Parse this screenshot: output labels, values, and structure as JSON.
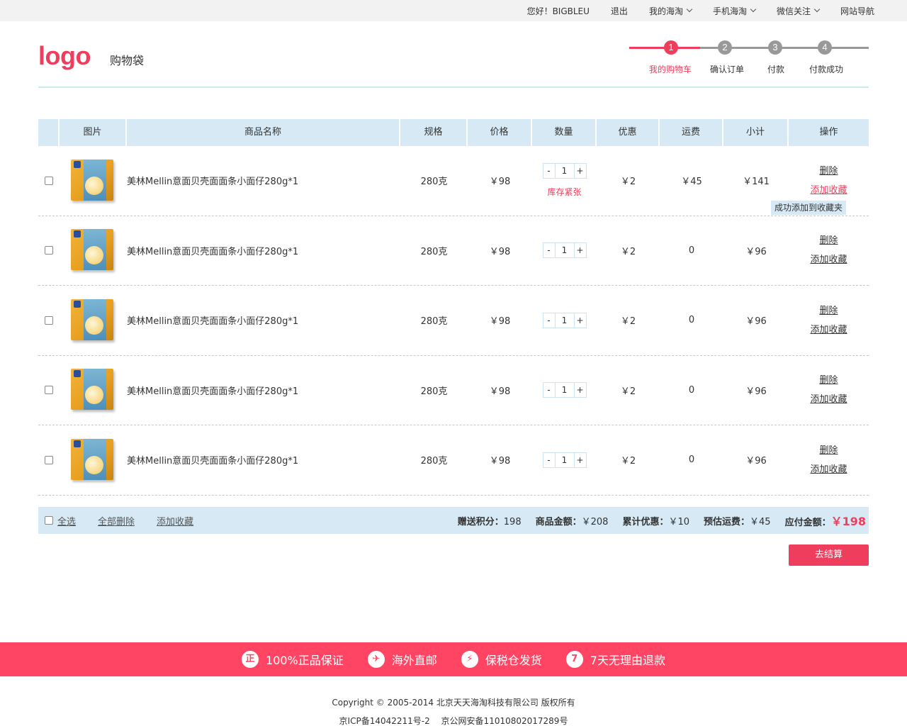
{
  "topnav": {
    "greeting": "您好！BIGBLEU",
    "logout": "退出",
    "my_haitao": "我的海淘",
    "mobile": "手机海淘",
    "wechat": "微信关注",
    "site_nav": "网站导航"
  },
  "header": {
    "logo": "logo",
    "subtitle": "购物袋"
  },
  "steps": [
    {
      "num": "1",
      "label": "我的购物车",
      "active": true
    },
    {
      "num": "2",
      "label": "确认订单",
      "active": false
    },
    {
      "num": "3",
      "label": "付款",
      "active": false
    },
    {
      "num": "4",
      "label": "付款成功",
      "active": false
    }
  ],
  "colors": {
    "accent": "#ef3d5d",
    "table_header": "#d6e9f5",
    "banner": "#ff4563",
    "inactive_step": "#999999"
  },
  "table": {
    "headers": {
      "image": "图片",
      "name": "商品名称",
      "spec": "规格",
      "price": "价格",
      "qty": "数量",
      "discount": "优惠",
      "shipping": "运费",
      "subtotal": "小计",
      "action": "操作"
    },
    "rows": [
      {
        "name": "美林Mellin意面贝壳面面条小面仔280g*1",
        "spec": "280克",
        "price": "￥98",
        "qty": "1",
        "discount": "￥2",
        "shipping": "￥45",
        "subtotal": "￥141",
        "stock_note": "库存紧张",
        "delete": "删除",
        "favorite": "添加收藏",
        "tip": "成功添加到收藏夹"
      },
      {
        "name": "美林Mellin意面贝壳面面条小面仔280g*1",
        "spec": "280克",
        "price": "￥98",
        "qty": "1",
        "discount": "￥2",
        "shipping": "0",
        "subtotal": "￥96",
        "delete": "删除",
        "favorite": "添加收藏"
      },
      {
        "name": "美林Mellin意面贝壳面面条小面仔280g*1",
        "spec": "280克",
        "price": "￥98",
        "qty": "1",
        "discount": "￥2",
        "shipping": "0",
        "subtotal": "￥96",
        "delete": "删除",
        "favorite": "添加收藏"
      },
      {
        "name": "美林Mellin意面贝壳面面条小面仔280g*1",
        "spec": "280克",
        "price": "￥98",
        "qty": "1",
        "discount": "￥2",
        "shipping": "0",
        "subtotal": "￥96",
        "delete": "删除",
        "favorite": "添加收藏"
      },
      {
        "name": "美林Mellin意面贝壳面面条小面仔280g*1",
        "spec": "280克",
        "price": "￥98",
        "qty": "1",
        "discount": "￥2",
        "shipping": "0",
        "subtotal": "￥96",
        "delete": "删除",
        "favorite": "添加收藏"
      }
    ],
    "qty_minus": "-",
    "qty_plus": "+"
  },
  "summary": {
    "select_all": "全选",
    "delete_all": "全部删除",
    "add_favorite": "添加收藏",
    "points_label": "赠送积分：",
    "points_value": "198",
    "goods_label": "商品金额：",
    "goods_value": "￥208",
    "discount_label": "累计优惠：",
    "discount_value": "￥10",
    "shipping_label": "预估运费：",
    "shipping_value": "￥45",
    "total_label": "应付金额：",
    "total_value": "￥198"
  },
  "checkout": "去结算",
  "banner": [
    {
      "icon": "正",
      "text": "100%正品保证"
    },
    {
      "icon": "✈",
      "text": "海外直邮"
    },
    {
      "icon": "⚡",
      "text": "保税仓发货"
    },
    {
      "icon": "7",
      "text": "7天无理由退款"
    }
  ],
  "footer": {
    "copyright": "Copyright © 2005-2014 北京天天海淘科技有限公司 版权所有",
    "icp": "京ICP备14042211号-2　 京公网安备11010802017289号"
  }
}
